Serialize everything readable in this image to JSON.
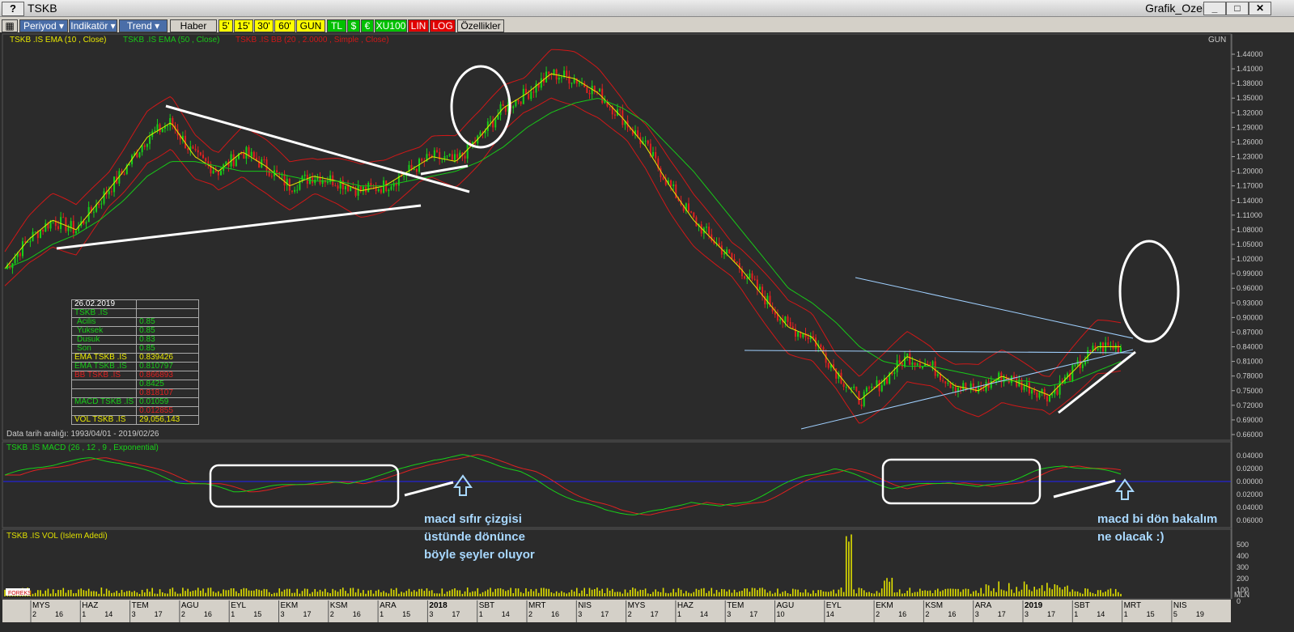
{
  "window": {
    "title": "TSKB",
    "name": "Grafik_Ozel",
    "help": "?",
    "btn_min": "_",
    "btn_max": "□",
    "btn_close": "✕"
  },
  "toolbar": {
    "periyod": "Periyod",
    "indikator": "Indikatör",
    "trend": "Trend",
    "haber": "Haber",
    "p5": "5'",
    "p15": "15'",
    "p30": "30'",
    "p60": "60'",
    "gun": "GUN",
    "tl": "TL",
    "dollar": "$",
    "euro": "€",
    "xu100": "XU100",
    "lin": "LIN",
    "log": "LOG",
    "ozellikler": "Özellikler"
  },
  "colors": {
    "bg": "#2b2b2b",
    "ema10": "#e8e800",
    "ema50": "#18c818",
    "bb": "#d01818",
    "macd": "#18d018",
    "signal": "#e02020",
    "zero": "#2020ff",
    "vol": "#e0e000",
    "up": "#18d018",
    "down": "#e02020",
    "annot": "#ffffff",
    "trend_blue": "#a0d0ff"
  },
  "price_panel": {
    "legend_ema10": "TSKB .IS EMA (10 , Close)",
    "legend_ema50": "TSKB .IS EMA (50 , Close)",
    "legend_bb": "TSKB .IS BB (20 , 2.0000 , Simple , Close)",
    "period": "GUN",
    "date_range": "Data tarih aralığı: 1993/04/01 - 2019/02/26",
    "y_ticks": [
      "1.44000",
      "1.41000",
      "1.38000",
      "1.35000",
      "1.32000",
      "1.29000",
      "1.26000",
      "1.23000",
      "1.20000",
      "1.17000",
      "1.14000",
      "1.11000",
      "1.08000",
      "1.05000",
      "1.02000",
      "0.99000",
      "0.96000",
      "0.93000",
      "0.90000",
      "0.87000",
      "0.84000",
      "0.81000",
      "0.78000",
      "0.75000",
      "0.72000",
      "0.69000",
      "0.66000"
    ]
  },
  "info": {
    "date": "26.02.2019",
    "symbol": "TSKB .IS",
    "acilis_l": "Acilis",
    "acilis_v": "0.85",
    "yuksek_l": "Yuksek",
    "yuksek_v": "0.85",
    "dusuk_l": "Dusuk",
    "dusuk_v": "0.83",
    "son_l": "Son",
    "son_v": "0.85",
    "ema1_l": "EMA TSKB .IS",
    "ema1_v": "0.839426",
    "ema2_l": "EMA TSKB .IS",
    "ema2_v": "0.810797",
    "bb_l": "BB TSKB .IS",
    "bb_v1": "0.866893",
    "bb_v2": "0.8425",
    "bb_v3": "0.818107",
    "macd_l": "MACD TSKB .IS",
    "macd_v1": "0.01059",
    "macd_v2": "0.012855",
    "vol_l": "VOL TSKB .IS",
    "vol_v": "29,056,143"
  },
  "macd_panel": {
    "legend": "TSKB .IS MACD (26 , 12 , 9 , Exponential)",
    "y_ticks": [
      "0.04000",
      "0.02000",
      "0.00000",
      "0.02000",
      "0.04000",
      "0.06000"
    ]
  },
  "vol_panel": {
    "legend": "TSKB .IS VOL (Islem Adedi)",
    "y_ticks": [
      "500",
      "400",
      "300",
      "200",
      "100",
      "0"
    ],
    "unit": "MLN",
    "logo": "FOREKS"
  },
  "x_axis": [
    {
      "m": "MYS",
      "d": "2",
      "d2": "16"
    },
    {
      "m": "HAZ",
      "d": "1",
      "d2": "14"
    },
    {
      "m": "TEM",
      "d": "3",
      "d2": "17"
    },
    {
      "m": "AGU",
      "d": "2",
      "d2": "16"
    },
    {
      "m": "EYL",
      "d": "1",
      "d2": "15"
    },
    {
      "m": "EKM",
      "d": "3",
      "d2": "17"
    },
    {
      "m": "KSM",
      "d": "2",
      "d2": "16"
    },
    {
      "m": "ARA",
      "d": "1",
      "d2": "15"
    },
    {
      "m": "2018",
      "d": "3",
      "d2": "17"
    },
    {
      "m": "SBT",
      "d": "1",
      "d2": "14"
    },
    {
      "m": "MRT",
      "d": "2",
      "d2": "16"
    },
    {
      "m": "NIS",
      "d": "3",
      "d2": "17"
    },
    {
      "m": "MYS",
      "d": "2",
      "d2": "17"
    },
    {
      "m": "HAZ",
      "d": "1",
      "d2": "14"
    },
    {
      "m": "TEM",
      "d": "3",
      "d2": "17"
    },
    {
      "m": "AGU",
      "d": "10",
      "d2": ""
    },
    {
      "m": "EYL",
      "d": "14",
      "d2": ""
    },
    {
      "m": "EKM",
      "d": "2",
      "d2": "16"
    },
    {
      "m": "KSM",
      "d": "2",
      "d2": "16"
    },
    {
      "m": "ARA",
      "d": "3",
      "d2": "17"
    },
    {
      "m": "2019",
      "d": "3",
      "d2": "17"
    },
    {
      "m": "SBT",
      "d": "1",
      "d2": "14"
    },
    {
      "m": "MRT",
      "d": "1",
      "d2": "15"
    },
    {
      "m": "NIS",
      "d": "5",
      "d2": "19"
    }
  ],
  "notes": {
    "left": [
      "macd sıfır çizgisi",
      "üstünde dönünce",
      "böyle şeyler oluyor"
    ],
    "right": [
      "macd bi dön bakalım",
      "ne olacak :)"
    ]
  },
  "chart_data": {
    "type": "line",
    "title": "TSKB",
    "series": [
      {
        "name": "TSKB .IS EMA (10 , Close)",
        "values": [
          1.0,
          1.06,
          1.1,
          1.08,
          1.14,
          1.2,
          1.27,
          1.3,
          1.23,
          1.2,
          1.24,
          1.21,
          1.17,
          1.19,
          1.18,
          1.16,
          1.17,
          1.2,
          1.23,
          1.22,
          1.27,
          1.33,
          1.36,
          1.4,
          1.39,
          1.36,
          1.31,
          1.25,
          1.17,
          1.1,
          1.05,
          1.0,
          0.94,
          0.88,
          0.86,
          0.79,
          0.73,
          0.77,
          0.82,
          0.8,
          0.76,
          0.75,
          0.78,
          0.76,
          0.74,
          0.79,
          0.84,
          0.84
        ]
      },
      {
        "name": "TSKB .IS EMA (50 , Close)",
        "values": [
          1.0,
          1.02,
          1.05,
          1.07,
          1.1,
          1.14,
          1.19,
          1.22,
          1.22,
          1.21,
          1.2,
          1.2,
          1.19,
          1.18,
          1.18,
          1.17,
          1.17,
          1.18,
          1.19,
          1.2,
          1.22,
          1.25,
          1.29,
          1.32,
          1.34,
          1.35,
          1.33,
          1.3,
          1.25,
          1.2,
          1.14,
          1.08,
          1.02,
          0.96,
          0.93,
          0.89,
          0.84,
          0.81,
          0.8,
          0.8,
          0.79,
          0.78,
          0.77,
          0.77,
          0.76,
          0.77,
          0.79,
          0.81
        ]
      },
      {
        "name": "MACD",
        "values": [
          0.01,
          0.02,
          0.03,
          0.035,
          0.03,
          0.015,
          0.0,
          -0.005,
          -0.015,
          -0.01,
          -0.005,
          0.0,
          -0.005,
          0.01,
          0.02,
          0.035,
          0.04,
          0.03,
          0.015,
          -0.01,
          -0.03,
          -0.045,
          -0.05,
          -0.045,
          -0.03,
          -0.04,
          -0.03,
          -0.01,
          0.01,
          0.02,
          0.005,
          -0.01,
          -0.005,
          0.0,
          -0.01,
          0.0,
          0.015,
          0.025,
          0.02,
          0.011
        ]
      }
    ],
    "ylim": [
      0.66,
      1.44
    ]
  }
}
